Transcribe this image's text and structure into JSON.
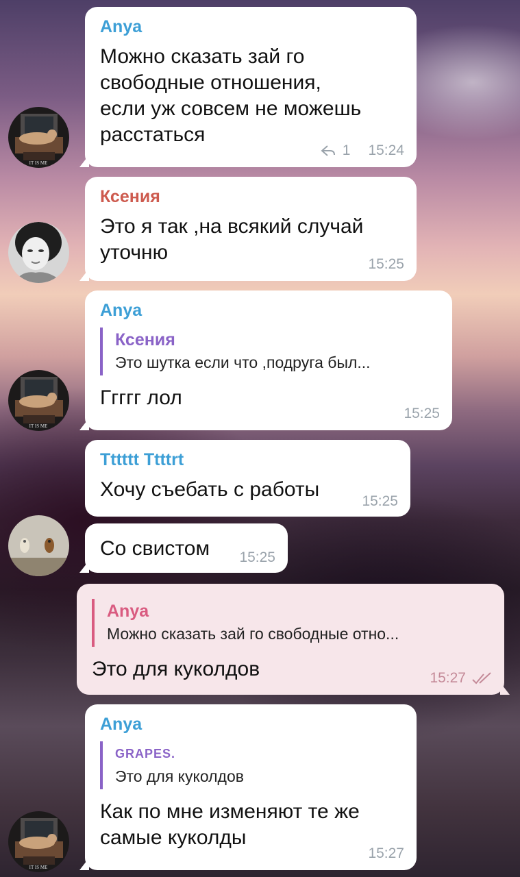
{
  "colors": {
    "anya": "#3d9fd6",
    "ksenia": "#cd5a4e",
    "reply_bar": "#8a63c7",
    "outgoing_bubble": "#f7e6ea",
    "outgoing_accent": "#d95b80"
  },
  "messages": [
    {
      "sender": "Anya",
      "text": "Можно сказать зай го\nсвободные отношения,\nесли уж совсем не можешь\nрасстаться",
      "reply_count": "1",
      "time": "15:24",
      "avatar": "cat-photo-avatar",
      "avatar_caption": "IT IS ME"
    },
    {
      "sender": "Ксения",
      "text": "Это я так ,на всякий случай\nуточню",
      "time": "15:25",
      "avatar": "girl-photo-avatar"
    },
    {
      "sender": "Anya",
      "reply_to_name": "Ксения",
      "reply_to_text": "Это шутка если что ,подруга был...",
      "text": "Ггггг лол",
      "time": "15:25",
      "avatar": "cat-photo-avatar",
      "avatar_caption": "IT IS ME"
    },
    {
      "sender": "Tttttt Ttttrt",
      "text": "Хочу съебать с работы",
      "time": "15:25"
    },
    {
      "text": "Со свистом",
      "time": "15:25",
      "avatar": "owls-photo-avatar"
    },
    {
      "outgoing": true,
      "reply_to_name": "Anya",
      "reply_to_text": "Можно сказать зай го свободные отно...",
      "text": "Это для куколдов",
      "time": "15:27",
      "status": "double-check-icon"
    },
    {
      "sender": "Anya",
      "reply_to_name": "GRAPES.",
      "reply_to_text": "Это для куколдов",
      "text": "Как по мне изменяют те же\nсамые куколды",
      "time": "15:27",
      "avatar": "cat-photo-avatar",
      "avatar_caption": "IT IS ME"
    }
  ]
}
